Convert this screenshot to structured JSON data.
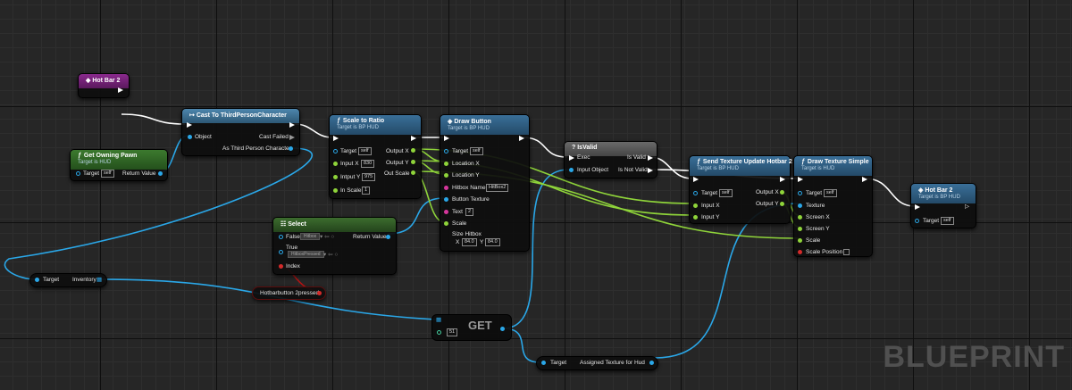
{
  "nodes": {
    "hot_bar_event": {
      "title": "Hot Bar 2"
    },
    "get_owning_pawn": {
      "title": "Get Owning Pawn",
      "subtitle": "Target is HUD",
      "target_label": "Target",
      "target_value": "self",
      "return_label": "Return Value"
    },
    "cast": {
      "title": "Cast To ThirdPersonCharacter",
      "object_label": "Object",
      "failed_label": "Cast Failed",
      "as_label": "As Third Person Character"
    },
    "scale_to_ratio": {
      "title": "Scale to Ratio",
      "subtitle": "Target is BP HUD",
      "target_label": "Target",
      "target_value": "self",
      "input_x_label": "Input X",
      "input_x_value": "830",
      "input_y_label": "Intput Y",
      "input_y_value": "975",
      "in_scale_label": "In Scale",
      "in_scale_value": "1",
      "output_x_label": "Output X",
      "output_y_label": "Output Y",
      "out_scale_label": "Out Scale"
    },
    "draw_button": {
      "title": "Draw Button",
      "subtitle": "Target is BP HUD",
      "target_label": "Target",
      "target_value": "self",
      "location_x_label": "Location X",
      "location_y_label": "Location Y",
      "hitbox_name_label": "Hitbox Name",
      "hitbox_name_value": "HitBox2",
      "button_texture_label": "Button Texture",
      "text_label": "Text",
      "text_value": "2",
      "scale_label": "Scale",
      "size_hitbox_label": "Size Hitbox",
      "size_x_label": "X",
      "size_x_value": "84.0",
      "size_y_label": "Y",
      "size_y_value": "84.0"
    },
    "select": {
      "title": "Select",
      "false_label": "False",
      "false_value": "Hitbox",
      "true_label": "True",
      "true_value": "HitboxPressed",
      "index_label": "Index",
      "return_label": "Return Value"
    },
    "inventory_get": {
      "target_label": "Target",
      "inventory_label": "Inventory"
    },
    "hotbar_var": {
      "label": "Hotbarbutton 2pressed"
    },
    "array_get": {
      "label": "GET",
      "index_value": "51"
    },
    "assigned_texture": {
      "target_label": "Target",
      "label": "Assigned Texture for Hud"
    },
    "is_valid": {
      "title": "IsValid",
      "exec_label": "Exec",
      "input_label": "Input Object",
      "is_valid_label": "Is Valid",
      "is_not_valid_label": "Is Not Valid"
    },
    "send_texture": {
      "title": "Send Texture Update Hotbar 2",
      "subtitle": "Target is BP HUD",
      "target_label": "Target",
      "target_value": "self",
      "input_x_label": "Input X",
      "input_y_label": "Input Y",
      "output_x_label": "Output X",
      "output_y_label": "Output Y"
    },
    "draw_texture": {
      "title": "Draw Texture Simple",
      "subtitle": "Target is HUD",
      "target_label": "Target",
      "target_value": "self",
      "texture_label": "Texture",
      "screen_x_label": "Screen X",
      "screen_y_label": "Screen Y",
      "scale_label": "Scale",
      "scale_position_label": "Scale Position"
    },
    "hot_bar_2_call": {
      "title": "Hot Bar 2",
      "subtitle": "Target is BP HUD",
      "target_label": "Target",
      "target_value": "self"
    }
  },
  "watermark": "BLUEPRINT",
  "colors": {
    "exec_wire": "#ffffff",
    "object_wire": "#2aa7e8",
    "float_wire": "#8fd43a",
    "bool_wire": "#b01414",
    "event_header": "#7b1e7e",
    "function_header": "#2e5f86",
    "cast_header": "#3e6d8c",
    "pure_header": "#3c6c2e",
    "isvalid_header": "#5a5a5a"
  }
}
